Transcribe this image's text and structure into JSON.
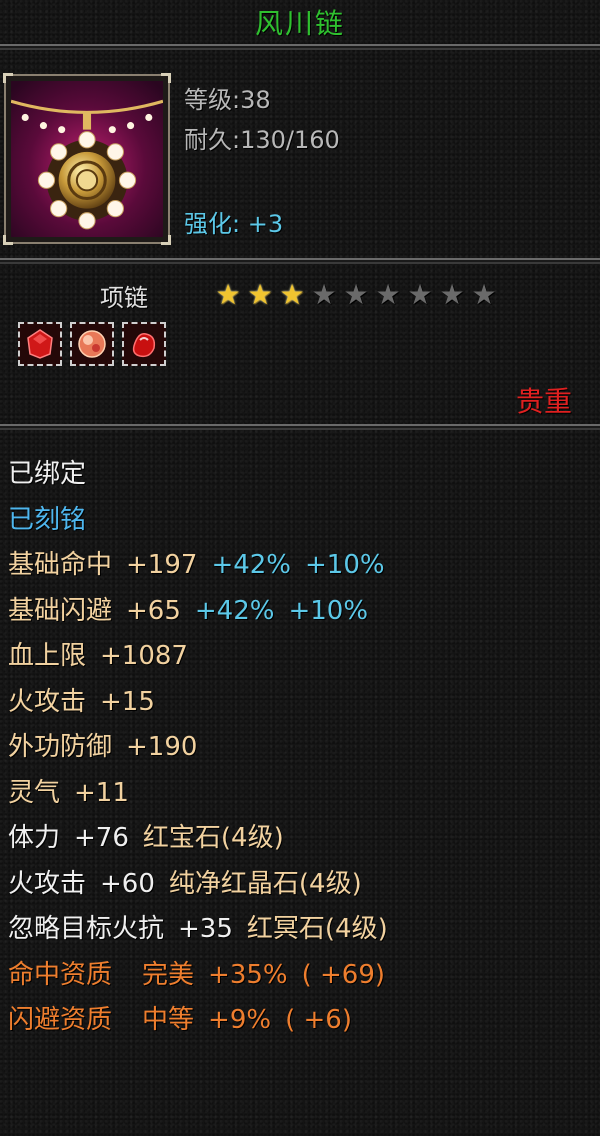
{
  "item": {
    "name": "风川链",
    "level_text": "等级:38",
    "durability_text": "耐久:130/160",
    "enhance_text": "强化: +3",
    "type": "项链",
    "quality": "贵重",
    "stars": {
      "filled": 3,
      "total": 9
    },
    "icon": "necklace-icon",
    "gems": [
      "red-gem-icon",
      "pink-gem-icon",
      "red-crystal-icon"
    ]
  },
  "stats": {
    "bound": "已绑定",
    "engraved": "已刻铭",
    "hit": {
      "label": "基础命中",
      "value": "+197",
      "bonus1": "+42%",
      "bonus2": "+10%"
    },
    "dodge": {
      "label": "基础闪避",
      "value": "+65",
      "bonus1": "+42%",
      "bonus2": "+10%"
    },
    "hp": {
      "label": "血上限",
      "value": "+1087"
    },
    "fire_attack": {
      "label": "火攻击",
      "value": "+15"
    },
    "outer_defense": {
      "label": "外功防御",
      "value": "+190"
    },
    "spirit": {
      "label": "灵气",
      "value": "+11"
    },
    "gem1": {
      "label": "体力",
      "value": "+76",
      "gem": "红宝石(4级)"
    },
    "gem2": {
      "label": "火攻击",
      "value": "+60",
      "gem": "纯净红晶石(4级)"
    },
    "gem3": {
      "label": "忽略目标火抗",
      "value": "+35",
      "gem": "红冥石(4级)"
    },
    "aptitude_hit": {
      "label": "命中资质",
      "grade": "完美",
      "value": "+35%",
      "extra": "( +69)"
    },
    "aptitude_dodge": {
      "label": "闪避资质",
      "grade": "中等",
      "value": "+9%",
      "extra": "( +6)"
    }
  },
  "colors": {
    "title": "#2fc02f",
    "quality": "#e02020",
    "engraved": "#4eb6ee",
    "base_stat": "#f2d2a0",
    "aptitude": "#ee7e2e",
    "star_on": "#f0c430",
    "star_off": "#6a6a6a"
  }
}
